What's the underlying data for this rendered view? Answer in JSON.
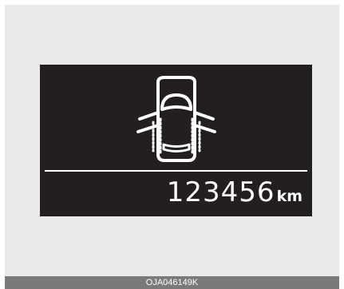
{
  "cluster_display": {
    "icon": "car-doors-open-icon",
    "odometer_value": "123456",
    "odometer_unit": "km"
  },
  "caption": {
    "code": "OJA046149K"
  },
  "colors": {
    "display_background": "#231f20",
    "panel_background": "#e9e9e9",
    "caption_background": "#7a7a7a",
    "foreground": "#ffffff"
  }
}
